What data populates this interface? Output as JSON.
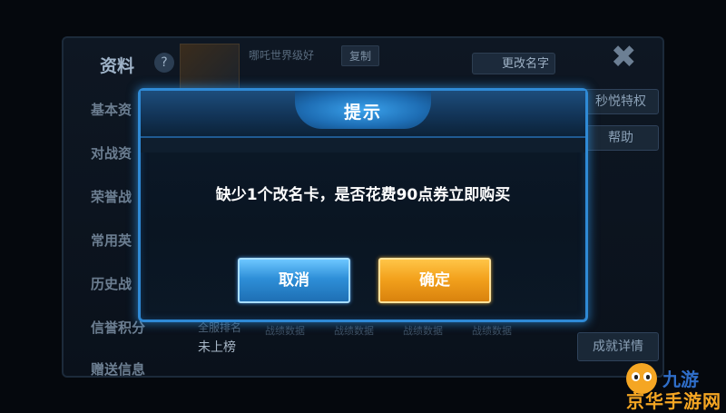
{
  "background": {
    "panel_title": "资料",
    "help_glyph": "?",
    "player_name": "哪吒世界级好",
    "copy_label": "复制",
    "rename_label": "更改名字",
    "close_glyph": "✖",
    "side_tabs": [
      "基本资",
      "对战资",
      "荣誉战",
      "常用英",
      "历史战",
      "信誉积分",
      "赠送信息"
    ],
    "right_buttons": [
      "秒悦特权",
      "帮助"
    ],
    "rank_label": "全服排名",
    "rank_value": "未上榜",
    "stats": [
      "战绩数据",
      "战绩数据",
      "战绩数据",
      "战绩数据"
    ],
    "achievement_button": "成就详情"
  },
  "dialog": {
    "title": "提示",
    "message": "缺少1个改名卡，是否花费90点券立即购买",
    "cancel_label": "取消",
    "confirm_label": "确定"
  },
  "watermark": {
    "top": "九游",
    "bottom": "京华手游网"
  },
  "colors": {
    "dialog_border": "#2f8ad6",
    "cancel_button": "#2e8fd8",
    "confirm_button": "#f3a21d"
  }
}
